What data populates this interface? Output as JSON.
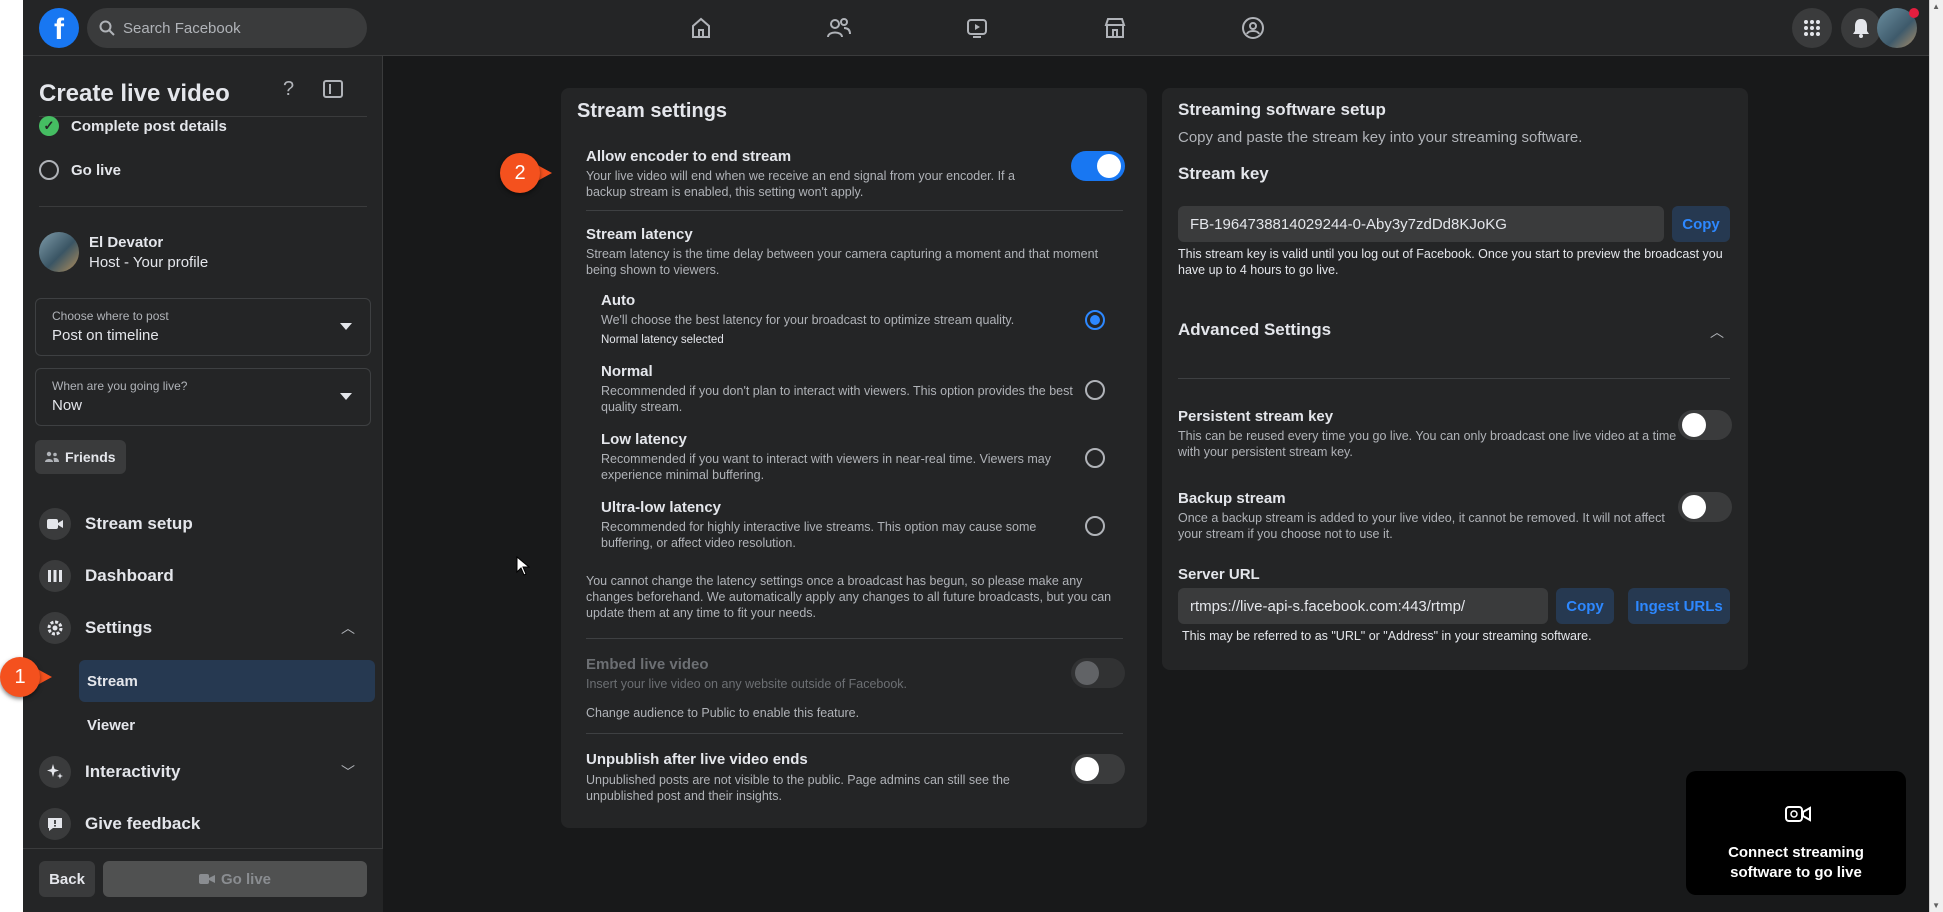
{
  "topnav": {
    "search_placeholder": "Search Facebook",
    "logo_letter": "f",
    "nav_icons": [
      "home-icon",
      "friends-icon",
      "watch-icon",
      "marketplace-icon",
      "groups-icon"
    ],
    "right_icons": [
      "menu-grid-icon",
      "notifications-icon",
      "profile-avatar"
    ]
  },
  "sidebar": {
    "title": "Create live video",
    "help": "?",
    "steps": [
      {
        "label": "Complete post details",
        "done": true
      },
      {
        "label": "Go live",
        "done": false
      }
    ],
    "host": {
      "name": "El Devator",
      "role": "Host - Your profile"
    },
    "where": {
      "label": "Choose where to post",
      "value": "Post on timeline"
    },
    "when": {
      "label": "When are you going live?",
      "value": "Now"
    },
    "audience": "Friends",
    "nav": {
      "stream_setup": "Stream setup",
      "dashboard": "Dashboard",
      "settings": "Settings",
      "stream": "Stream",
      "viewer": "Viewer",
      "interactivity": "Interactivity",
      "feedback": "Give feedback"
    },
    "back": "Back",
    "golive": "Go live"
  },
  "stream_settings": {
    "title": "Stream settings",
    "encoder": {
      "title": "Allow encoder to end stream",
      "desc": "Your live video will end when we receive an end signal from your encoder. If a backup stream is enabled, this setting won't apply.",
      "enabled": true
    },
    "latency": {
      "title": "Stream latency",
      "desc": "Stream latency is the time delay between your camera capturing a moment and that moment being shown to viewers.",
      "options": [
        {
          "title": "Auto",
          "desc": "We'll choose the best latency for your broadcast to optimize stream quality.",
          "note": "Normal latency selected",
          "selected": true
        },
        {
          "title": "Normal",
          "desc": "Recommended if you don't plan to interact with viewers. This option provides the best quality stream.",
          "selected": false
        },
        {
          "title": "Low latency",
          "desc": "Recommended if you want to interact with viewers in near-real time. Viewers may experience minimal buffering.",
          "selected": false
        },
        {
          "title": "Ultra-low latency",
          "desc": "Recommended for highly interactive live streams. This option may cause some buffering, or affect video resolution.",
          "selected": false
        }
      ],
      "footnote": "You cannot change the latency settings once a broadcast has begun, so please make any changes beforehand. We automatically apply any changes to all future broadcasts, but you can update them at any time to fit your needs."
    },
    "embed": {
      "title": "Embed live video",
      "desc": "Insert your live video on any website outside of Facebook.",
      "note": "Change audience to Public to enable this feature.",
      "enabled": false
    },
    "unpublish": {
      "title": "Unpublish after live video ends",
      "desc": "Unpublished posts are not visible to the public. Page admins can still see the unpublished post and their insights.",
      "enabled": false
    }
  },
  "software_setup": {
    "title": "Streaming software setup",
    "subtitle": "Copy and paste the stream key into your streaming software.",
    "key_label": "Stream key",
    "key_value": "FB-1964738814029244-0-Aby3y7zdDd8KJoKG",
    "copy": "Copy",
    "key_note": "This stream key is valid until you log out of Facebook. Once you start to preview the broadcast you have up to 4 hours to go live.",
    "advanced": "Advanced Settings",
    "persistent": {
      "title": "Persistent stream key",
      "desc": "This can be reused every time you go live. You can only broadcast one live video at a time with your persistent stream key.",
      "enabled": false
    },
    "backup": {
      "title": "Backup stream",
      "desc": "Once a backup stream is added to your live video, it cannot be removed. It will not affect your stream if you choose not to use it.",
      "enabled": false
    },
    "server_label": "Server URL",
    "server_value": "rtmps://live-api-s.facebook.com:443/rtmp/",
    "ingest": "Ingest URLs",
    "server_note": "This may be referred to as \"URL\" or \"Address\" in your streaming software."
  },
  "connect_card": {
    "text": "Connect streaming software to go live"
  },
  "callouts": [
    "1",
    "2"
  ],
  "colors": {
    "accent": "#1877f2",
    "callout": "#f4511e",
    "active_bg": "#263951",
    "success": "#45bd62"
  }
}
